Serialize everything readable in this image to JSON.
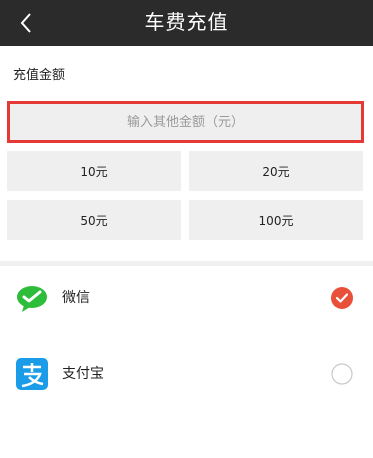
{
  "header": {
    "title": "车费充值",
    "background_color": "#2b2b2b"
  },
  "recharge": {
    "section_label": "充值金额",
    "input_placeholder": "输入其他金额（元）",
    "highlight_color": "#e53935",
    "amounts": [
      "10元",
      "20元",
      "50元",
      "100元"
    ]
  },
  "payment_methods": [
    {
      "label": "微信",
      "icon": "wechat-icon",
      "selected": true
    },
    {
      "label": "支付宝",
      "icon": "alipay-icon",
      "selected": false
    }
  ]
}
